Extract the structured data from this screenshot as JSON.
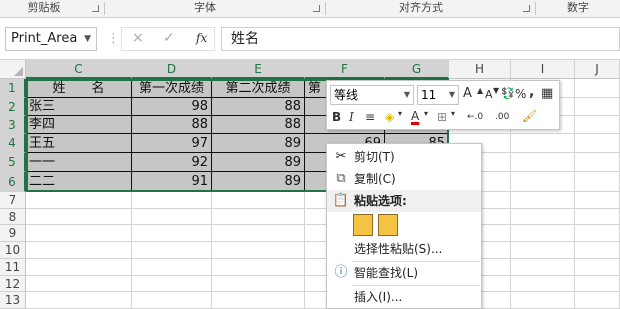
{
  "ribbon": {
    "groups": [
      "剪贴板",
      "字体",
      "对齐方式",
      "数字"
    ]
  },
  "formula_bar": {
    "name_box": "Print_Area",
    "cancel_icon": "×",
    "enter_icon": "✓",
    "fx_label": "fx",
    "formula_value": "姓名"
  },
  "columns": [
    "C",
    "D",
    "E",
    "F",
    "G",
    "H",
    "I",
    "J"
  ],
  "rows": [
    "1",
    "2",
    "3",
    "4",
    "5",
    "6",
    "7",
    "8",
    "9",
    "10",
    "11",
    "12",
    "13"
  ],
  "cells": {
    "C1": "姓　　名",
    "D1": "第一次成绩",
    "E1": "第二次成绩",
    "F1": "第",
    "C2": "张三",
    "D2": "98",
    "E2": "88",
    "C3": "李四",
    "D3": "88",
    "E3": "88",
    "C4": "王五",
    "D4": "97",
    "E4": "89",
    "F4": "69",
    "G4": "85",
    "C5": "一一",
    "D5": "92",
    "E5": "89",
    "C6": "二二",
    "D6": "91",
    "E6": "89"
  },
  "mini_toolbar": {
    "font_name": "等线",
    "font_size": "11",
    "grow_font": "A",
    "shrink_font": "A",
    "percent": "%",
    "comma": ",",
    "bold": "B",
    "italic": "I",
    "font_color_letter": "A",
    "inc_decimal": "←.0",
    "dec_decimal": ".00"
  },
  "context_menu": {
    "cut": "剪切(T)",
    "copy": "复制(C)",
    "paste_options": "粘贴选项:",
    "paste_special": "选择性粘贴(S)...",
    "smart_lookup": "智能查找(L)",
    "insert": "插入(I)..."
  },
  "colors": {
    "accent": "#217346",
    "selection_fill": "#c6c6c6"
  }
}
